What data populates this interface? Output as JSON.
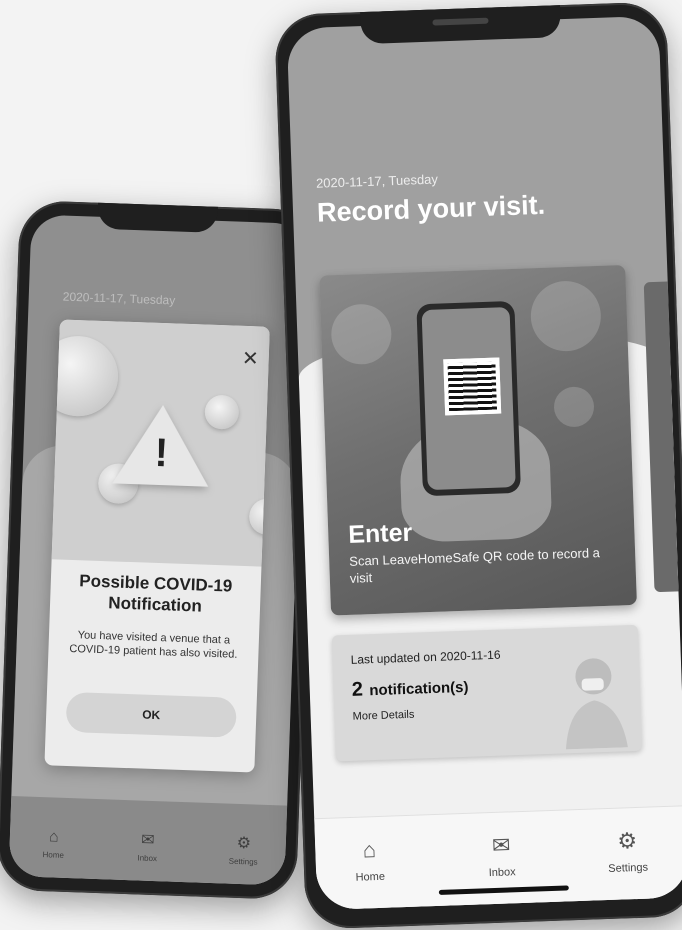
{
  "left_phone": {
    "date": "2020-11-17, Tuesday",
    "modal": {
      "title": "Possible COVID-19 Notification",
      "body": "You have visited a venue that a COVID-19 patient has also visited.",
      "ok_label": "OK",
      "close_icon": "close-icon"
    },
    "tabs": [
      {
        "label": "Home",
        "icon": "home-icon"
      },
      {
        "label": "Inbox",
        "icon": "inbox-icon"
      },
      {
        "label": "Settings",
        "icon": "gear-icon"
      }
    ]
  },
  "right_phone": {
    "date": "2020-11-17, Tuesday",
    "title": "Record your visit.",
    "enter_card": {
      "title": "Enter",
      "subtitle": "Scan LeaveHomeSafe QR code to record a visit"
    },
    "notification_card": {
      "updated": "Last updated on 2020-11-16",
      "count": "2",
      "count_label": "notification(s)",
      "more": "More Details"
    },
    "tabs": [
      {
        "label": "Home",
        "icon": "home-icon"
      },
      {
        "label": "Inbox",
        "icon": "inbox-icon"
      },
      {
        "label": "Settings",
        "icon": "gear-icon"
      }
    ]
  }
}
